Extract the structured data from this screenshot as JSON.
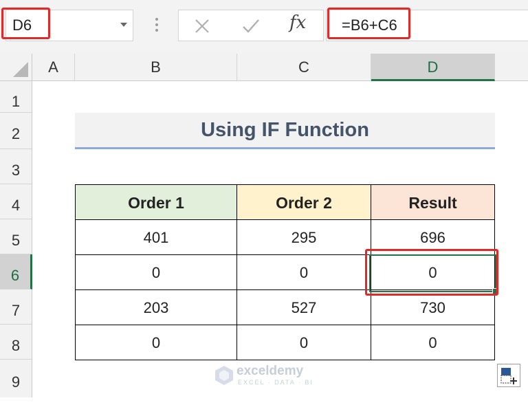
{
  "formula_bar": {
    "name_box": "D6",
    "formula": "=B6+C6",
    "fx_label": "fx",
    "cancel_icon": "close-icon",
    "enter_icon": "checkmark-icon"
  },
  "columns": [
    "A",
    "B",
    "C",
    "D"
  ],
  "rows": [
    "1",
    "2",
    "3",
    "4",
    "5",
    "6",
    "7",
    "8",
    "9"
  ],
  "selected_cell": "D6",
  "sheet": {
    "title": "Using IF Function",
    "headers": [
      "Order 1",
      "Order 2",
      "Result"
    ],
    "data": [
      [
        "401",
        "295",
        "696"
      ],
      [
        "0",
        "0",
        "0"
      ],
      [
        "203",
        "527",
        "730"
      ],
      [
        "0",
        "0",
        "0"
      ]
    ]
  },
  "watermark": {
    "brand": "exceldemy",
    "tagline": "EXCEL · DATA · BI"
  },
  "colors": {
    "header_order1": "#e2efda",
    "header_order2": "#fff2cc",
    "header_result": "#fce4d6",
    "highlight_red": "#e02a2a",
    "excel_green": "#217346",
    "title_text": "#44546a"
  }
}
